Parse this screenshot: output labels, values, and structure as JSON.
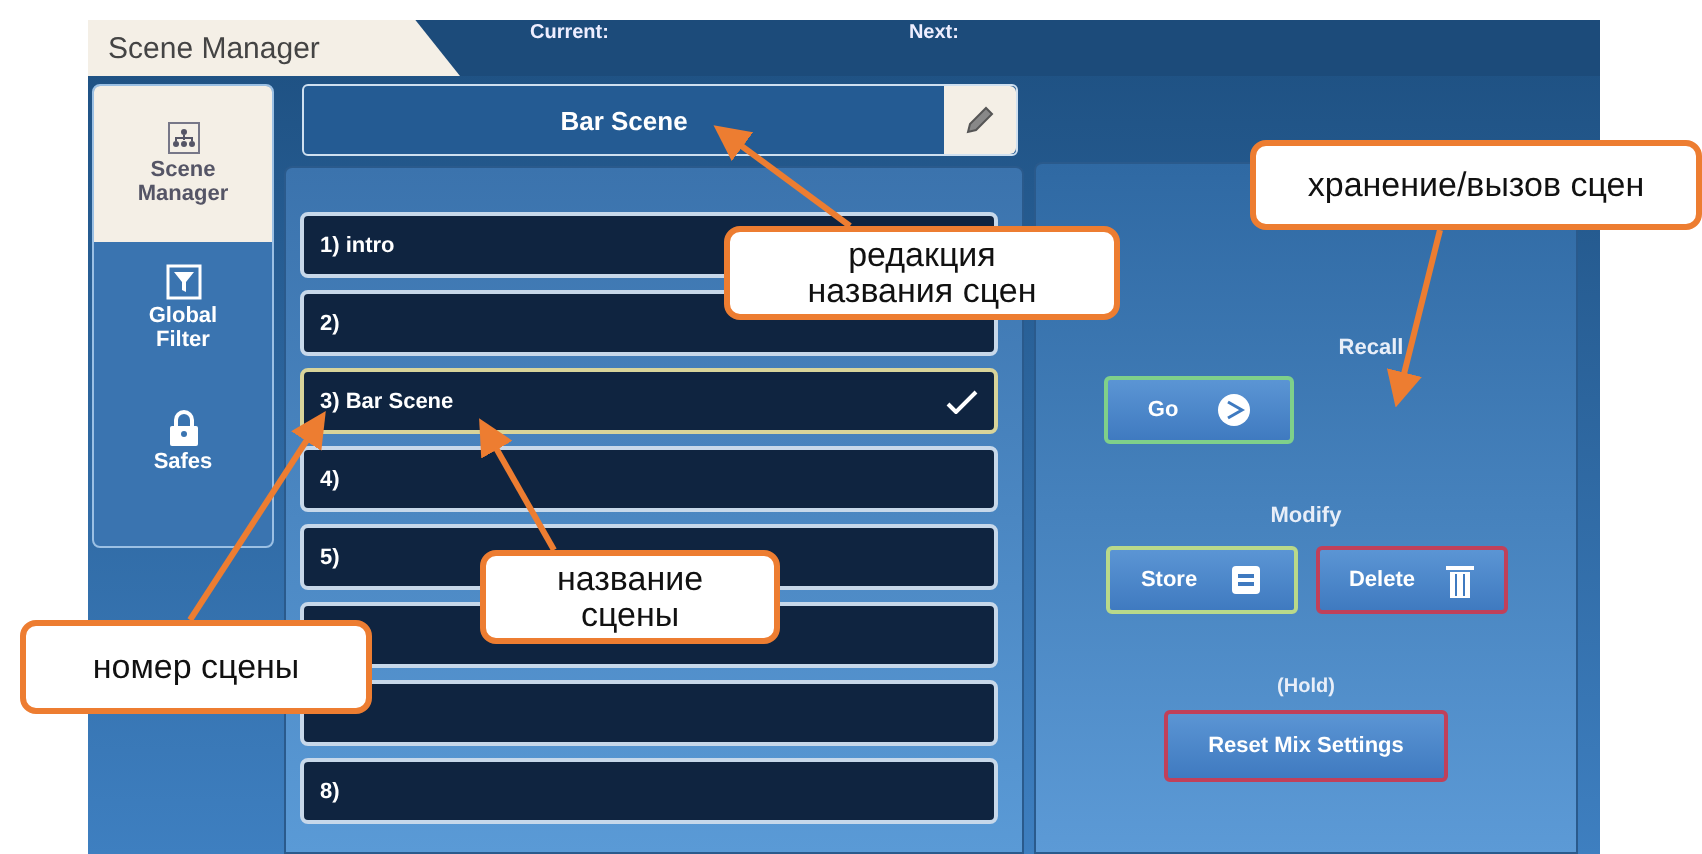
{
  "window": {
    "title": "Scene Manager"
  },
  "header": {
    "current_label": "Current:",
    "next_label": "Next:"
  },
  "sidebar": {
    "items": [
      {
        "label": "Scene Manager",
        "kind": "scenes",
        "selected": true
      },
      {
        "label": "Global Filter",
        "kind": "filter",
        "selected": false
      },
      {
        "label": "Safes",
        "kind": "lock",
        "selected": false
      }
    ]
  },
  "scene_name": {
    "value": "Bar Scene"
  },
  "scenes": [
    {
      "label": "1) intro",
      "selected": false
    },
    {
      "label": "2)",
      "selected": false
    },
    {
      "label": "3) Bar Scene",
      "selected": true
    },
    {
      "label": "4)",
      "selected": false
    },
    {
      "label": "5)",
      "selected": false
    },
    {
      "selected": false
    },
    {
      "selected": false
    },
    {
      "label": "8)",
      "selected": false
    }
  ],
  "actions": {
    "recall_heading": "Recall",
    "modify_heading": "Modify",
    "hold_note": "(Hold)",
    "go": {
      "label": "Go",
      "color": "#7fd08a"
    },
    "store": {
      "label": "Store",
      "color": "#b9d98a"
    },
    "delete": {
      "label": "Delete",
      "color": "#c0405a"
    },
    "reset": {
      "label": "Reset Mix Settings",
      "color": "#c0405a"
    }
  },
  "callouts": [
    {
      "text": "хранение/вызов сцен"
    },
    {
      "text": "редакция\nназвания сцен"
    },
    {
      "text": "название\nсцены"
    },
    {
      "text": "номер сцены"
    }
  ]
}
